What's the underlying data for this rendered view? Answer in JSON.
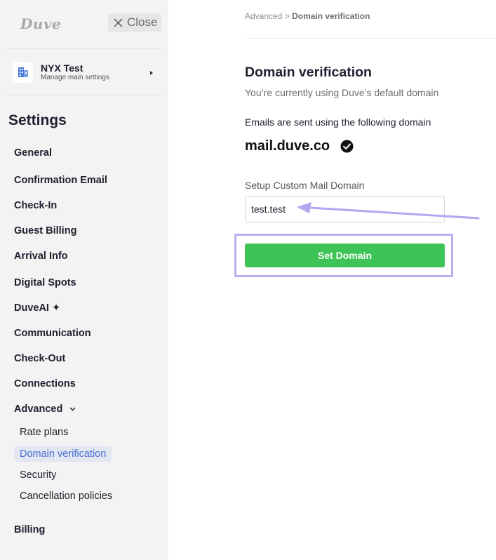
{
  "sidebar": {
    "logo": "Duve",
    "close_label": "Close",
    "property": {
      "name": "NYX Test",
      "subtitle": "Manage main settings"
    },
    "settings_title": "Settings",
    "items": [
      {
        "label": "General"
      },
      {
        "label": "Confirmation Email"
      },
      {
        "label": "Check-In"
      },
      {
        "label": "Guest Billing"
      },
      {
        "label": "Arrival Info"
      },
      {
        "label": "Digital Spots"
      },
      {
        "label": "DuveAI ✦"
      },
      {
        "label": "Communication"
      },
      {
        "label": "Check-Out"
      },
      {
        "label": "Connections"
      },
      {
        "label": "Advanced"
      },
      {
        "label": "Billing"
      }
    ],
    "advanced_subitems": [
      {
        "label": "Rate plans"
      },
      {
        "label": "Domain verification",
        "active": true
      },
      {
        "label": "Security"
      },
      {
        "label": "Cancellation policies"
      }
    ]
  },
  "breadcrumb": {
    "parent": "Advanced",
    "separator": ">",
    "current": "Domain verification"
  },
  "main": {
    "title": "Domain verification",
    "subtitle": "You’re currently using Duve’s default domain",
    "emails_label": "Emails are sent using the following domain",
    "current_domain": "mail.duve.co",
    "field_label": "Setup Custom Mail Domain",
    "input_value": "test.test",
    "set_domain_label": "Set Domain"
  },
  "colors": {
    "accent_green": "#3ec456",
    "active_nav_bg": "#e2e7f2",
    "active_nav_text": "#4a6fd1",
    "annotation_purple": "#b9aef0"
  },
  "icons": {
    "close": "close-x-icon",
    "property": "building-icon",
    "verified": "check-circle-icon",
    "advanced_chevron": "chevron-down-icon",
    "annotation": "arrow-left-icon"
  }
}
